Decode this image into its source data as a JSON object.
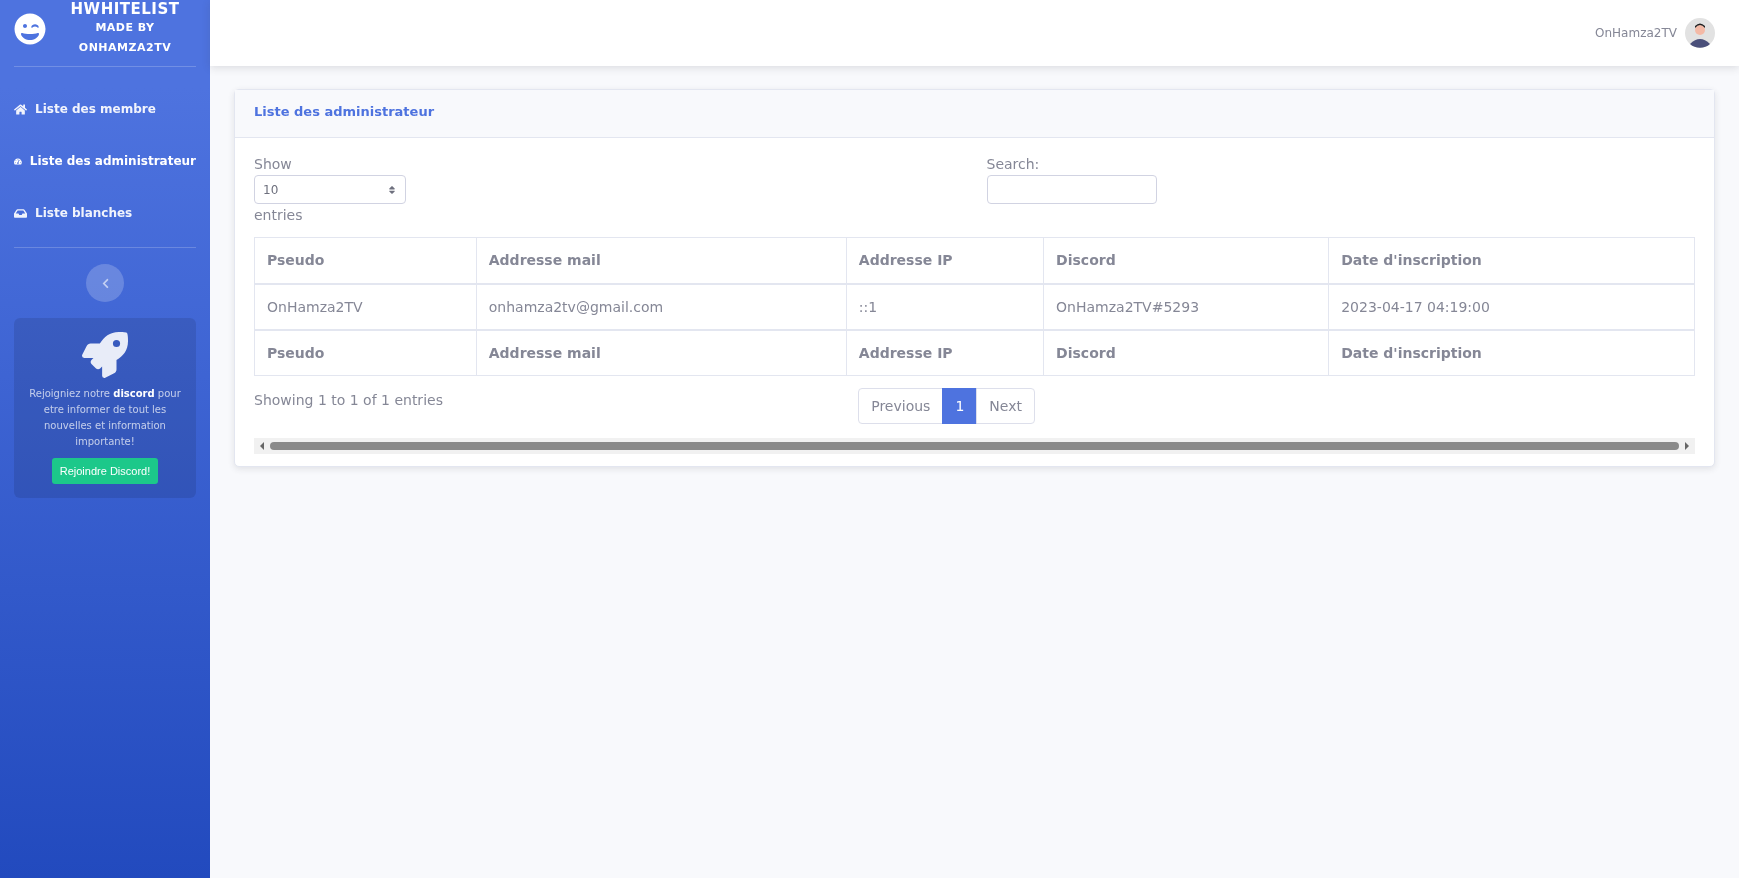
{
  "brand": {
    "title": "HWHITELIST",
    "subtitle": "MADE BY",
    "author": "ONHAMZA2TV"
  },
  "sidebar": {
    "items": [
      {
        "label": "Liste des membre",
        "selected": false
      },
      {
        "label": "Liste des administrateur",
        "selected": true
      },
      {
        "label": "Liste blanches",
        "selected": false
      }
    ],
    "promo": {
      "text": "Rejoigniez notre **discord** pour etre informer de tout les nouvelles et information importante!",
      "button": "Rejoindre Discord!"
    }
  },
  "topbar": {
    "user": "OnHamza2TV"
  },
  "card": {
    "title": "Liste des administrateur",
    "length": {
      "before": "Show",
      "value": "10",
      "after": "entries"
    },
    "search": {
      "label": "Search:"
    },
    "table": {
      "columns": [
        "Pseudo",
        "Addresse mail",
        "Addresse IP",
        "Discord",
        "Date d'inscription"
      ],
      "rows": [
        [
          "OnHamza2TV",
          "onhamza2tv@gmail.com",
          "::1",
          "OnHamza2TV#5293",
          "2023-04-17 04:19:00"
        ]
      ],
      "footer": [
        "Pseudo",
        "Addresse mail",
        "Addresse IP",
        "Discord",
        "Date d'inscription"
      ]
    },
    "info": "Showing 1 to 1 of 1 entries",
    "pagination": [
      {
        "label": "Previous",
        "selected": false
      },
      {
        "label": "1",
        "selected": true
      },
      {
        "label": "Next",
        "selected": false
      }
    ]
  }
}
